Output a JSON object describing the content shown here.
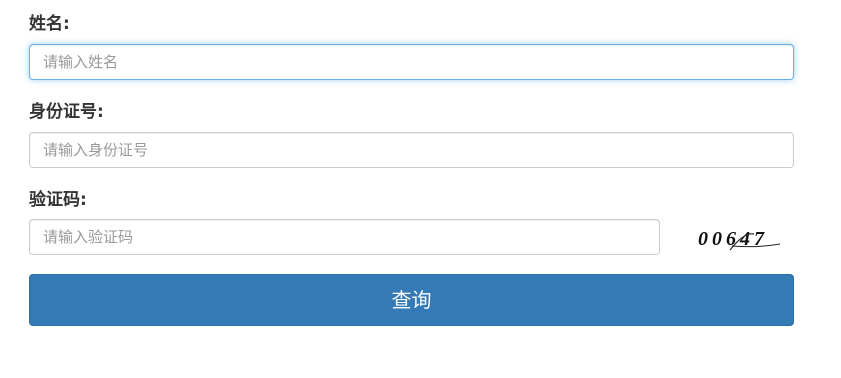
{
  "form": {
    "name_label": "姓名:",
    "name_placeholder": "请输入姓名",
    "id_label": "身份证号:",
    "id_placeholder": "请输入身份证号",
    "captcha_label": "验证码:",
    "captcha_placeholder": "请输入验证码",
    "captcha_image_text": "00647",
    "submit_label": "查询"
  },
  "colors": {
    "accent": "#337ab7",
    "focus_border": "#66afe9",
    "label_text": "#333333",
    "placeholder": "#999999"
  }
}
